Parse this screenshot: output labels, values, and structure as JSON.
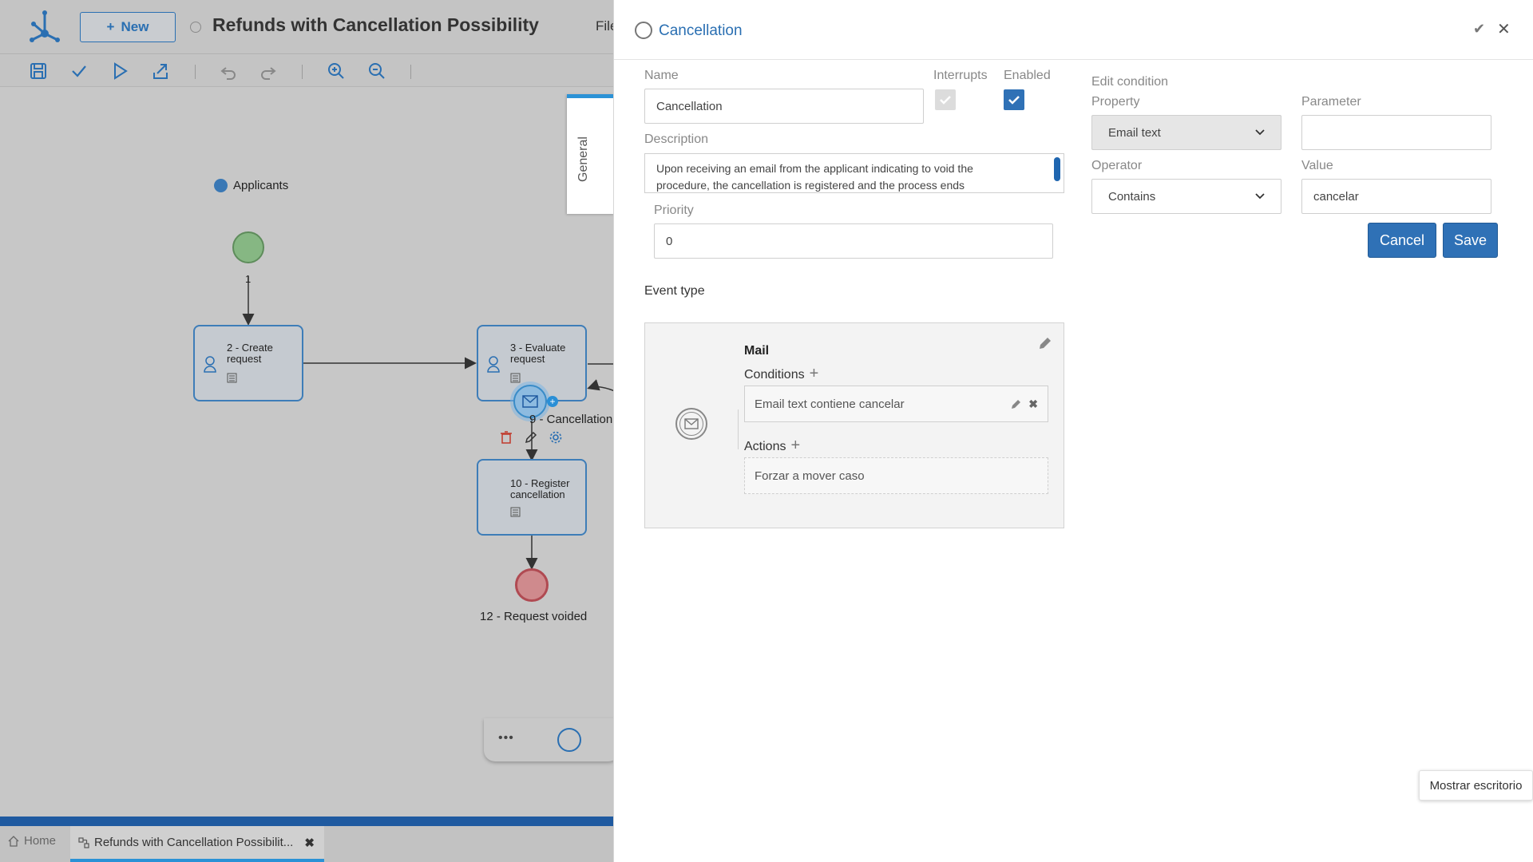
{
  "app": {
    "new_button": "New",
    "process_title": "Refunds with Cancellation Possibility",
    "file_menu": "File"
  },
  "toolbar": {
    "icons": [
      "save-icon",
      "check-icon",
      "play-icon",
      "export-icon",
      "undo-icon",
      "redo-icon",
      "zoom-in-icon",
      "zoom-out-icon"
    ]
  },
  "side_tab": {
    "label": "General"
  },
  "diagram": {
    "pool_label": "Applicants",
    "flow_label": "1",
    "tasks": [
      {
        "label": "2 - Create request"
      },
      {
        "label": "3 - Evaluate request"
      },
      {
        "label": "10 - Register cancellation"
      }
    ],
    "boundary_event_label": "9 - Cancellation",
    "end_event_label": "12 - Request voided",
    "mini_toolbar_more": "•••"
  },
  "tabs": {
    "home": "Home",
    "document": "Refunds with Cancellation Possibilit..."
  },
  "panel": {
    "title": "Cancellation",
    "name_label": "Name",
    "name_value": "Cancellation",
    "interrupts_label": "Interrupts",
    "interrupts_checked": true,
    "interrupts_disabled": true,
    "enabled_label": "Enabled",
    "enabled_checked": true,
    "description_label": "Description",
    "description_value": "Upon receiving an email from the applicant indicating to void the procedure, the cancellation is registered and the process ends",
    "priority_label": "Priority",
    "priority_value": "0",
    "event_type_label": "Event type",
    "event_card": {
      "title": "Mail",
      "conditions_label": "Conditions",
      "condition_item": "Email text contiene cancelar",
      "actions_label": "Actions",
      "action_item": "Forzar a mover caso"
    },
    "edit_condition": {
      "heading": "Edit condition",
      "property_label": "Property",
      "property_value": "Email text",
      "parameter_label": "Parameter",
      "parameter_value": "",
      "operator_label": "Operator",
      "operator_value": "Contains",
      "value_label": "Value",
      "value_value": "cancelar",
      "cancel_button": "Cancel",
      "save_button": "Save"
    }
  },
  "tooltip": "Mostrar escritorio",
  "colors": {
    "accent": "#2f71b6",
    "start_event": "#86b783",
    "end_event": "#cf8a8d",
    "task_border": "#3e7db8"
  }
}
